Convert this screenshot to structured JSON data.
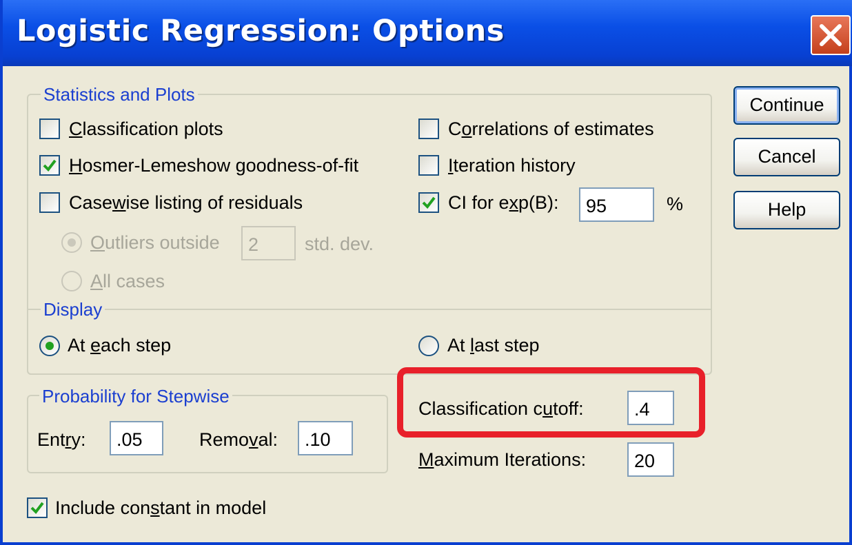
{
  "window": {
    "title": "Logistic Regression: Options"
  },
  "buttons": {
    "continue": "Continue",
    "cancel": "Cancel",
    "help": "Help"
  },
  "statistics": {
    "legend": "Statistics and Plots",
    "classification_plots": {
      "pre": "",
      "u": "C",
      "post": "lassification plots",
      "checked": false
    },
    "hosmer": {
      "pre": "",
      "u": "H",
      "post": "osmer-Lemeshow goodness-of-fit",
      "checked": true
    },
    "casewise": {
      "pre": "Case",
      "u": "w",
      "post": "ise listing of residuals",
      "checked": false
    },
    "outliers": {
      "pre": "",
      "u": "O",
      "post": "utliers outside",
      "value": "2",
      "unit": "std. dev.",
      "selected": true,
      "enabled": false
    },
    "all_cases": {
      "pre": "",
      "u": "A",
      "post": "ll cases",
      "selected": false,
      "enabled": false
    },
    "correlations": {
      "pre": "C",
      "u": "o",
      "post": "rrelations of estimates",
      "checked": false
    },
    "iteration_history": {
      "pre": "",
      "u": "I",
      "post": "teration history",
      "checked": false
    },
    "ci": {
      "pre": "CI for e",
      "u": "x",
      "post": "p(B):",
      "checked": true,
      "value": "95",
      "unit": "%"
    }
  },
  "display": {
    "legend": "Display",
    "each_step": {
      "pre": "At ",
      "u": "e",
      "post": "ach step",
      "selected": true
    },
    "last_step": {
      "pre": "At ",
      "u": "l",
      "post": "ast step",
      "selected": false
    }
  },
  "probability": {
    "legend": "Probability for Stepwise",
    "entry": {
      "pre": "Ent",
      "u": "r",
      "post": "y:",
      "value": ".05"
    },
    "removal": {
      "pre": "Remo",
      "u": "v",
      "post": "al:",
      "value": ".10"
    }
  },
  "cutoff": {
    "pre": "Classification c",
    "u": "u",
    "post": "toff:",
    "value": ".4"
  },
  "max_iterations": {
    "pre": "",
    "u": "M",
    "post": "aximum Iterations:",
    "value": "20"
  },
  "include_constant": {
    "pre": "Include con",
    "u": "s",
    "post": "tant in model",
    "checked": true
  },
  "colors": {
    "title_bar": "#0a4fe6",
    "legend_text": "#1b3fd0",
    "check_mark": "#21a121",
    "highlight": "#e8202a"
  }
}
